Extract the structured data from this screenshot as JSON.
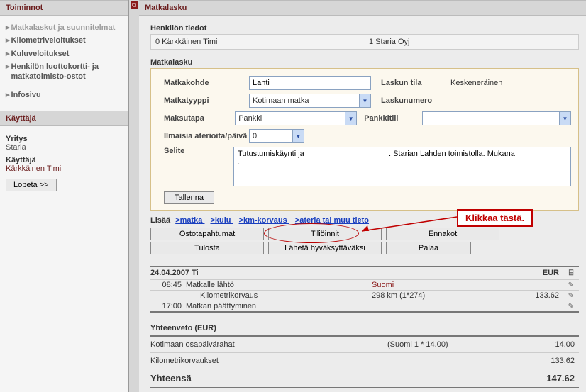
{
  "sidebar": {
    "header_functions": "Toiminnot",
    "items": [
      {
        "label": "Matkalaskut ja suunnitelmat",
        "active": true
      },
      {
        "label": "Kilometriveloitukset"
      },
      {
        "label": "Kuluveloitukset"
      },
      {
        "label": "Henkilön luottokortti- ja matkatoimisto-ostot"
      },
      {
        "label": "Infosivu"
      }
    ],
    "header_user": "Käyttäjä",
    "company_label": "Yritys",
    "company_value": "Staria",
    "user_label": "Käyttäjä",
    "user_value": "Kärkkäinen Timi",
    "logout_label": "Lopeta >>"
  },
  "page": {
    "title": "Matkalasku",
    "person_section_title": "Henkilön tiedot",
    "person_left": "0 Kärkkäinen Timi",
    "person_right": "1 Staria Oyj",
    "form_section_title": "Matkalasku",
    "form": {
      "destination_label": "Matkakohde",
      "destination_value": "Lahti",
      "status_label": "Laskun tila",
      "status_value": "Keskeneräinen",
      "triptype_label": "Matkatyyppi",
      "triptype_value": "Kotimaan matka",
      "invoiceno_label": "Laskunumero",
      "invoiceno_value": "",
      "paymethod_label": "Maksutapa",
      "paymethod_value": "Pankki",
      "bankacct_label": "Pankkitili",
      "bankacct_value": "",
      "freemeals_label": "Ilmaisia aterioita/päivä",
      "freemeals_value": "0",
      "description_label": "Selite",
      "description_value": "Tutustumiskäynti ja                                       . Starian Lahden toimistolla. Mukana                         .",
      "save_label": "Tallenna"
    },
    "add_line": {
      "label": "Lisää  ",
      "link_trip": ">matka ",
      "link_expense": ">kulu ",
      "link_km": ">km-korvaus ",
      "link_meal": ">ateria tai muu tieto"
    },
    "callout": "Klikkaa tästä.",
    "actions": {
      "purchases": "Ostotapahtumat",
      "entries": "Tiliöinnit",
      "advances": "Ennakot",
      "print": "Tulosta",
      "send_approve": "Lähetä hyväksyttäväksi",
      "back": "Palaa"
    },
    "itinerary": {
      "date_header": "24.04.2007 Ti",
      "currency_header": "EUR",
      "rows": [
        {
          "time": "08:45",
          "desc": "Matkalle lähtö",
          "meta": "Suomi",
          "meta_link": true,
          "amt": "",
          "icon": "pencil"
        },
        {
          "time": "",
          "desc": "Kilometrikorvaus",
          "meta": "298 km (1*274)",
          "amt": "133.62",
          "sub": true,
          "icon": "pencil"
        },
        {
          "time": "17:00",
          "desc": "Matkan päättyminen",
          "meta": "",
          "amt": "",
          "icon": "pencil"
        }
      ]
    },
    "summary": {
      "title": "Yhteenveto (EUR)",
      "rows": [
        {
          "label": "Kotimaan osapäivärahat",
          "meta": "(Suomi 1 * 14.00)",
          "amt": "14.00"
        },
        {
          "label": "Kilometrikorvaukset",
          "meta": "",
          "amt": "133.62"
        }
      ],
      "total_label": "Yhteensä",
      "total_value": "147.62"
    }
  }
}
